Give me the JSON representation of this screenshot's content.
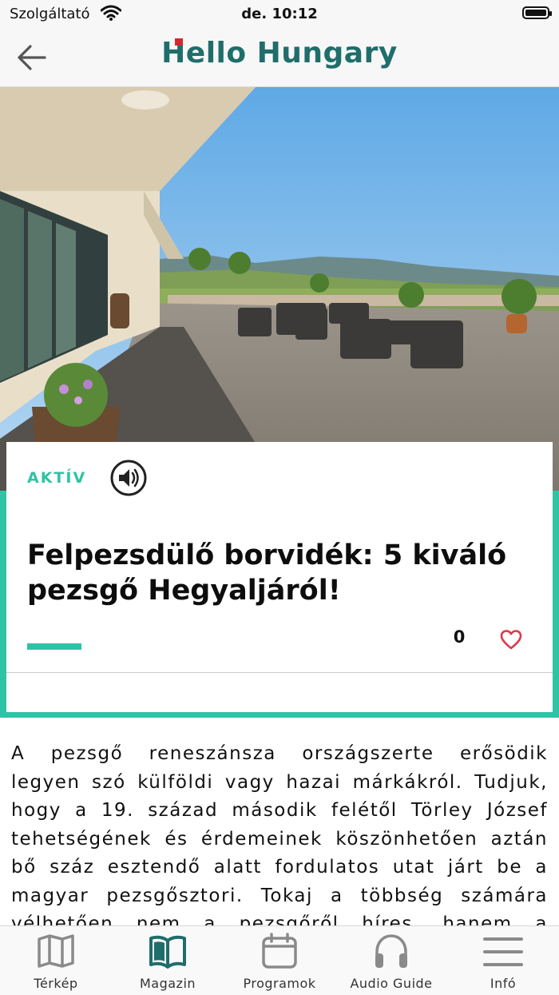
{
  "status_bar": {
    "carrier": "Szolgáltató",
    "time": "de. 10:12"
  },
  "header": {
    "logo_text": "Hello Hungary",
    "back_icon": "arrow-left-icon"
  },
  "article": {
    "category": "AKTÍV",
    "title": "Felpezsdülő borvidék: 5 kiváló pezsgő Hegyaljáról!",
    "like_count": "0",
    "body": "A pezsgő reneszánsza országszerte erősödik legyen szó külföldi vagy hazai márkákról. Tudjuk, hogy a 19. század második felétől Törley József tehetségének és érdemeinek köszönhetően aztán bő száz esztendő alatt fordulatos utat járt be a magyar pezsgősztori. Tokaj a többség számára vélhetően nem a pezsgőről híres, hanem a világhírű aszúról."
  },
  "colors": {
    "accent": "#2fc3a6",
    "brand": "#1f6e6b",
    "heart": "#e0374b"
  },
  "tabs": [
    {
      "label": "Térkép",
      "icon": "map-icon",
      "active": false
    },
    {
      "label": "Magazin",
      "icon": "open-book-icon",
      "active": true
    },
    {
      "label": "Programok",
      "icon": "calendar-icon",
      "active": false
    },
    {
      "label": "Audio Guide",
      "icon": "headphones-icon",
      "active": false
    },
    {
      "label": "Infó",
      "icon": "menu-icon",
      "active": false
    }
  ]
}
